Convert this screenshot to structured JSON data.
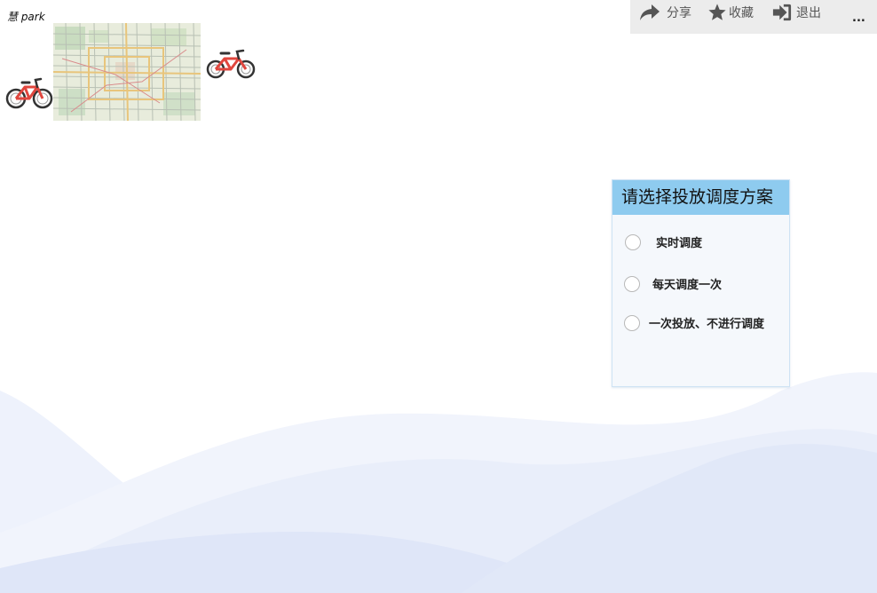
{
  "brand": {
    "text": "慧 park"
  },
  "toolbar": {
    "share": {
      "label": "分享",
      "icon": "share-icon"
    },
    "favorite": {
      "label": "收藏",
      "icon": "star-icon"
    },
    "exit": {
      "label": "退出",
      "icon": "sign-in-icon"
    },
    "more": {
      "label": "..."
    }
  },
  "images": {
    "bike_left": "bicycle-red-icon",
    "map": "city-map-thumbnail",
    "bike_right": "bicycle-red-icon"
  },
  "panel": {
    "title": "请选择投放调度方案",
    "options": [
      {
        "label": "实时调度",
        "selected": false
      },
      {
        "label": "每天调度一次",
        "selected": false
      },
      {
        "label": "一次投放、不进行调度",
        "selected": false
      }
    ]
  },
  "colors": {
    "panel_header": "#8ecbef",
    "toolbar_bg": "#ececec",
    "wave": "#e3e9f8"
  }
}
